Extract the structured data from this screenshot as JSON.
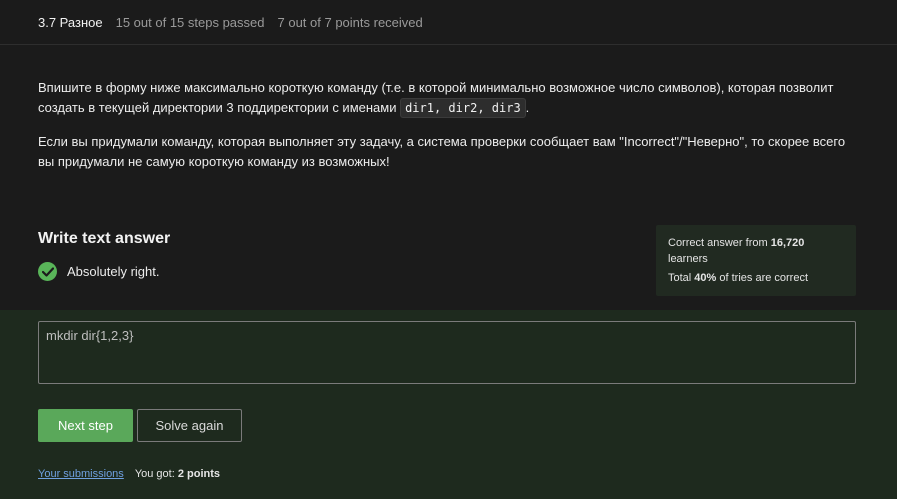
{
  "topbar": {
    "step_title": "3.7 Разное",
    "steps_passed": "15 out of 15 steps passed",
    "points": "7 out of 7 points  received"
  },
  "task": {
    "paragraph1_before": "Впишите в форму ниже максимально короткую команду (т.е. в которой минимально возможное число символов), которая позволит создать в текущей директории 3 поддиректории с именами ",
    "paragraph1_code": "dir1, dir2, dir3",
    "paragraph1_after": ".",
    "paragraph2": "Если вы придумали команду, которая выполняет эту задачу, а система проверки сообщает вам \"Incorrect\"/\"Неверно\", то скорее всего вы придумали не самую короткую команду из возможных!"
  },
  "answer": {
    "header": "Write text answer",
    "status_text": "Absolutely right.",
    "status_icon": "check-circle-icon",
    "value": "mkdir dir{1,2,3}"
  },
  "stats": {
    "correct_prefix": "Correct answer from ",
    "correct_count": "16,720",
    "correct_suffix": "learners",
    "total_prefix": "Total ",
    "total_percent": "40%",
    "total_suffix": " of tries are correct"
  },
  "actions": {
    "next_label": "Next step",
    "again_label": "Solve again"
  },
  "footer": {
    "submissions_label": "Your submissions",
    "you_got_prefix": "You got: ",
    "you_got_value": "2 points"
  },
  "colors": {
    "accent_green": "#5aa85a",
    "link_blue": "#6fa0e0",
    "background": "#1b1b1b",
    "answer_zone": "#1e2a1e"
  }
}
